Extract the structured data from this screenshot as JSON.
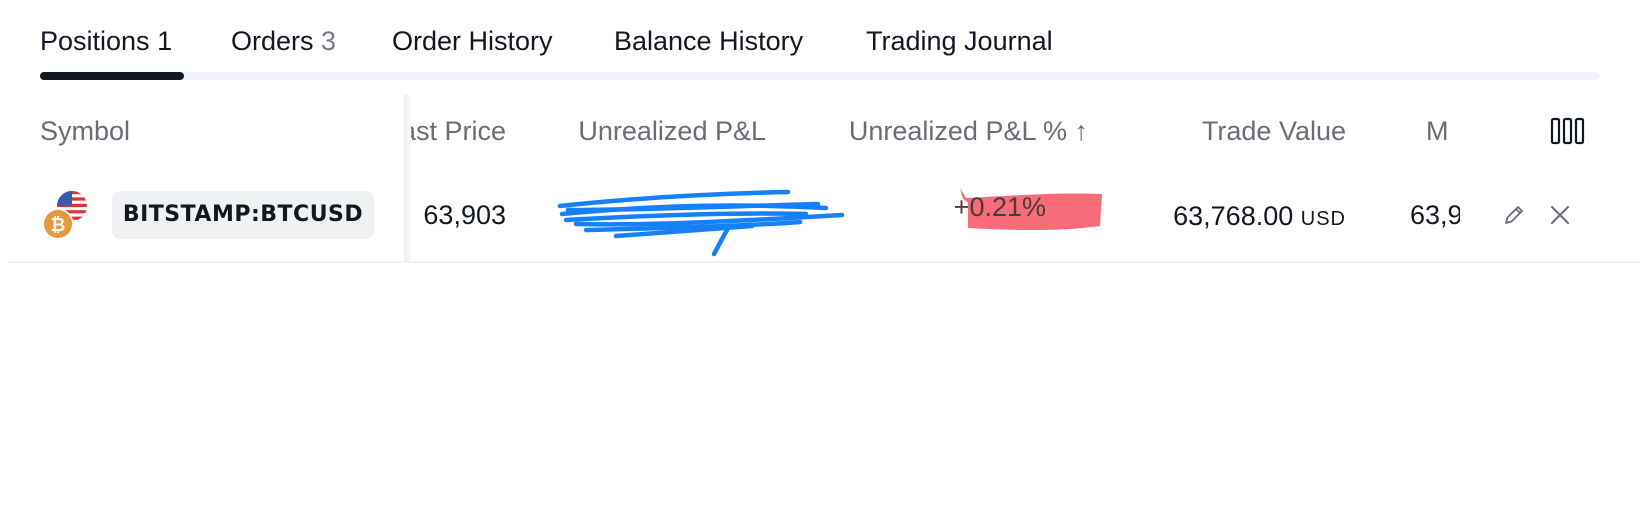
{
  "tabs": [
    {
      "label": "Positions",
      "count": "1",
      "active": true
    },
    {
      "label": "Orders",
      "count": "3",
      "active": false
    },
    {
      "label": "Order History",
      "count": "",
      "active": false
    },
    {
      "label": "Balance History",
      "count": "",
      "active": false
    },
    {
      "label": "Trading Journal",
      "count": "",
      "active": false
    }
  ],
  "table": {
    "columns": {
      "symbol": "Symbol",
      "last_price": "Last Price",
      "unrealized_pnl": "Unrealized P&L",
      "unrealized_pnl_pct": "Unrealized P&L % ↑",
      "trade_value": "Trade Value",
      "market_value": "M"
    },
    "rows": [
      {
        "symbol": "BITSTAMP:BTCUSD",
        "last_price": "63,903",
        "unrealized_pnl": "",
        "unrealized_pnl_pct": "+0.21%",
        "trade_value": "63,768.00",
        "trade_value_unit": "USD",
        "market_value": "63,9"
      }
    ]
  },
  "icons": {
    "coin": "bitcoin-icon",
    "flag": "us-flag-icon",
    "columns": "columns-settings-icon",
    "edit": "pencil-icon",
    "close": "close-icon"
  },
  "colors": {
    "accent": "#131722",
    "muted_text": "#6a6d78",
    "bitcoin": "#e8973a",
    "redaction_scribble": "#1580f7",
    "highlight_marker": "#f7606e"
  }
}
